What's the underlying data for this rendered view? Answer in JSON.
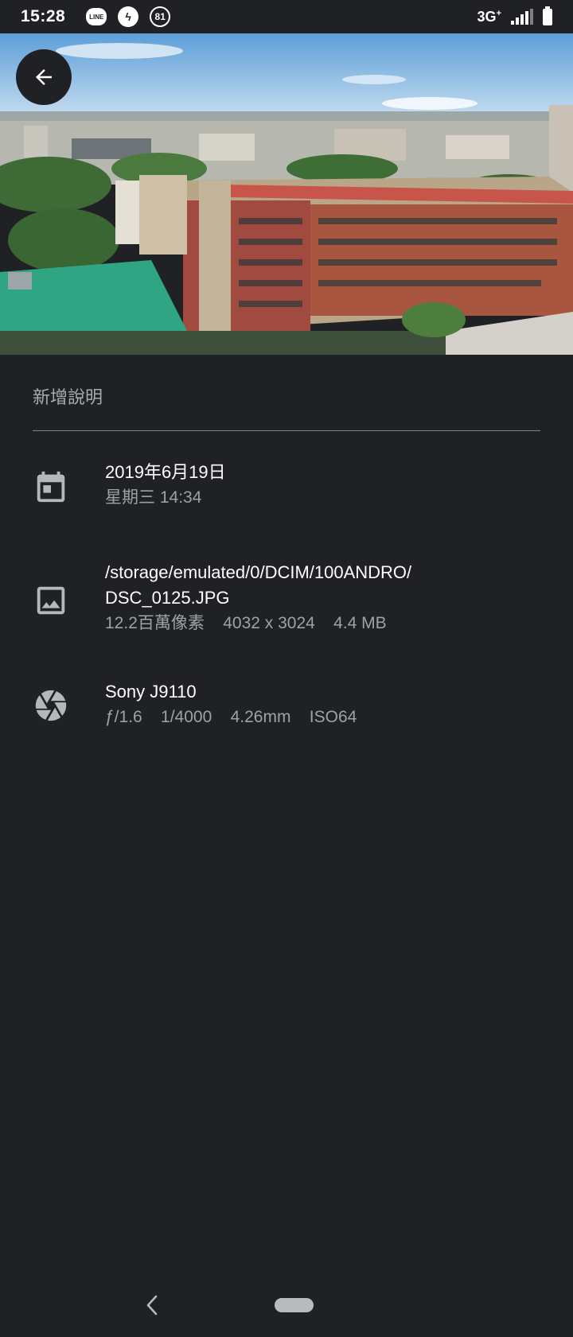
{
  "status_bar": {
    "time": "15:28",
    "notification_icons": [
      "line-icon",
      "bolt-icon",
      "badge-81-icon"
    ],
    "badge_count": "81",
    "line_label": "LINE",
    "network": "3G",
    "network_plus": "+"
  },
  "photo": {
    "alt": "city-rooftop-photo"
  },
  "caption": {
    "placeholder": "新增說明"
  },
  "date_info": {
    "icon": "calendar-icon",
    "date": "2019年6月19日",
    "weekday_time": "星期三 14:34"
  },
  "file_info": {
    "icon": "image-icon",
    "path_line1": "/storage/emulated/0/DCIM/100ANDRO/",
    "path_line2": "DSC_0125.JPG",
    "details": "12.2百萬像素    4032 x 3024    4.4 MB"
  },
  "camera_info": {
    "icon": "aperture-icon",
    "model": "Sony J9110",
    "exif": "ƒ/1.6    1/4000    4.26mm    ISO64"
  },
  "colors": {
    "background": "#202124",
    "primary_text": "#ffffff",
    "secondary_text": "#9ea1a6"
  }
}
